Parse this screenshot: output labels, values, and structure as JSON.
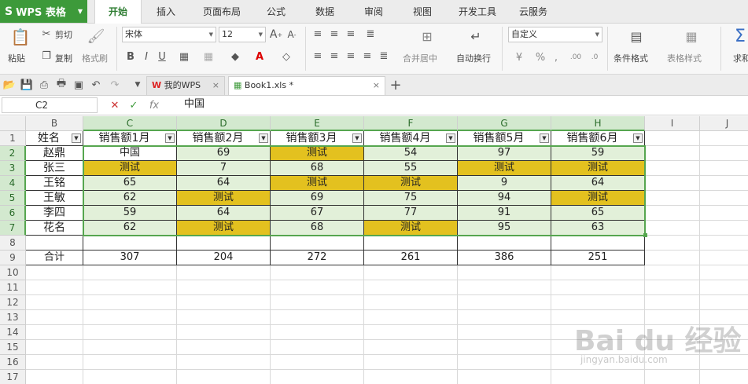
{
  "app": {
    "name": "WPS 表格"
  },
  "menu": [
    "开始",
    "插入",
    "页面布局",
    "公式",
    "数据",
    "审阅",
    "视图",
    "开发工具",
    "云服务"
  ],
  "ribbon": {
    "paste": "粘贴",
    "cut": "剪切",
    "copy": "复制",
    "format_painter": "格式刷",
    "font": "宋体",
    "size": "12",
    "merge_center": "合并居中",
    "wrap": "自动换行",
    "number_format": "自定义",
    "conditional": "条件格式",
    "table_style": "表格样式",
    "sum": "求和"
  },
  "tabs": {
    "home": "我的WPS",
    "file": "Book1.xls *"
  },
  "formula": {
    "cell": "C2",
    "content": "中国"
  },
  "columns": [
    "B",
    "C",
    "D",
    "E",
    "F",
    "G",
    "H",
    "I",
    "J"
  ],
  "rows": [
    "1",
    "2",
    "3",
    "4",
    "5",
    "6",
    "7",
    "8",
    "9",
    "10",
    "11",
    "12",
    "13",
    "14",
    "15",
    "16",
    "17"
  ],
  "table": {
    "headers": [
      "姓名",
      "销售额1月",
      "销售额2月",
      "销售额3月",
      "销售额4月",
      "销售额5月",
      "销售额6月"
    ],
    "data": [
      [
        "赵鼎",
        "中国",
        "69",
        "测试",
        "54",
        "97",
        "59"
      ],
      [
        "张三",
        "测试",
        "7",
        "68",
        "55",
        "测试",
        "测试"
      ],
      [
        "王铭",
        "65",
        "64",
        "测试",
        "测试",
        "9",
        "64"
      ],
      [
        "王敏",
        "62",
        "测试",
        "69",
        "75",
        "94",
        "测试"
      ],
      [
        "李四",
        "59",
        "64",
        "67",
        "77",
        "91",
        "65"
      ],
      [
        "花名",
        "62",
        "测试",
        "68",
        "测试",
        "95",
        "63"
      ]
    ],
    "total": [
      "合计",
      "307",
      "204",
      "272",
      "261",
      "386",
      "251"
    ]
  },
  "colors": {
    "accent": "#3d9a3a",
    "highlight": "#e2f0d9",
    "test_fill": "#e3c11f",
    "selection": "#56a64f"
  },
  "watermark": {
    "brand": "Bai du 经验",
    "url": "jingyan.baidu.com"
  }
}
